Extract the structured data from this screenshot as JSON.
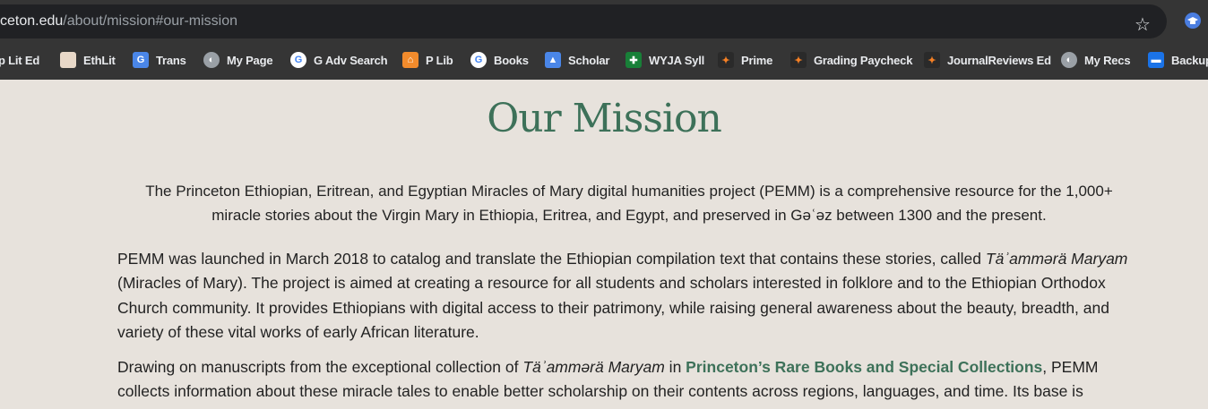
{
  "browser": {
    "url_host": "ceton.edu",
    "url_path": "/about/mission#our-mission"
  },
  "bookmarks": [
    {
      "label": "p Lit Ed",
      "icon": "book-icon"
    },
    {
      "label": "EthLit",
      "icon": "manuscript-icon"
    },
    {
      "label": "Trans",
      "icon": "translate-icon"
    },
    {
      "label": "My Page",
      "icon": "globe-icon"
    },
    {
      "label": "G Adv Search",
      "icon": "google-icon"
    },
    {
      "label": "P Lib",
      "icon": "library-icon"
    },
    {
      "label": "Books",
      "icon": "google-icon"
    },
    {
      "label": "Scholar",
      "icon": "scholar-icon"
    },
    {
      "label": "WYJA Syll",
      "icon": "sheet-icon"
    },
    {
      "label": "Prime",
      "icon": "princeton-icon"
    },
    {
      "label": "Grading Paycheck",
      "icon": "princeton-icon"
    },
    {
      "label": "JournalReviews Ed",
      "icon": "princeton-icon"
    },
    {
      "label": "My Recs",
      "icon": "globe-icon"
    },
    {
      "label": "Backup",
      "icon": "folder-icon"
    }
  ],
  "page": {
    "title": "Our Mission",
    "intro": "The Princeton Ethiopian, Eritrean, and Egyptian Miracles of Mary digital humanities project (PEMM) is a comprehensive resource for the 1,000+ miracle stories about the Virgin Mary in Ethiopia, Eritrea, and Egypt, and preserved in Gəʿəz between 1300 and the present.",
    "p1_a": "PEMM was launched in March 2018 to catalog and translate the Ethiopian compilation text that contains these stories, called ",
    "p1_em": "Täʾammərä Maryam",
    "p1_b": " (Miracles of Mary). The project is aimed at creating a resource for all students and scholars interested in folklore and to the Ethiopian Orthodox Church community. It provides Ethiopians with digital access to their patrimony, while raising general awareness about the beauty, breadth, and variety of these vital works of early African literature.",
    "p2_a": "Drawing on manuscripts from the exceptional collection of ",
    "p2_em": "Täʾammərä Maryam",
    "p2_b": " in ",
    "p2_link": "Princeton’s Rare Books and Special Collections",
    "p2_c": ", PEMM collects information about these miracle tales to enable better scholarship on their contents across regions, languages, and time. Its base is"
  }
}
